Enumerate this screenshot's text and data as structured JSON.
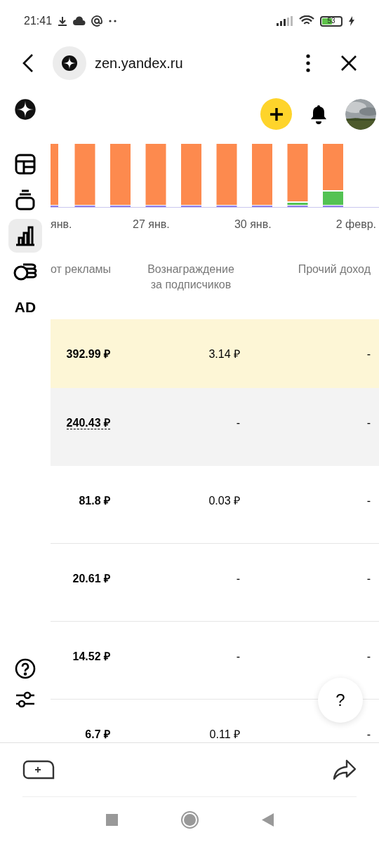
{
  "status_bar": {
    "time": "21:41",
    "battery": "53"
  },
  "browser_bar": {
    "url": "zen.yandex.ru"
  },
  "sidebar": {
    "items": [
      {
        "kind": "layout",
        "selected": false
      },
      {
        "kind": "stack",
        "selected": false
      },
      {
        "kind": "stats",
        "selected": true
      },
      {
        "kind": "coins",
        "selected": false
      },
      {
        "kind": "text",
        "label": "AD",
        "selected": false
      }
    ]
  },
  "chart": {
    "x_labels": [
      "янв.",
      "27 янв.",
      "30 янв.",
      "2 февр."
    ]
  },
  "table": {
    "columns": [
      "от рекламы",
      "Вознаграждение за подписчиков",
      "Прочий доход"
    ],
    "rows": [
      {
        "cells": [
          "392.99 ₽",
          "3.14 ₽",
          "-"
        ],
        "selected": true,
        "hovered": false
      },
      {
        "cells": [
          "240.43 ₽",
          "-",
          "-"
        ],
        "selected": false,
        "hovered": true
      },
      {
        "cells": [
          "81.8 ₽",
          "0.03 ₽",
          "-"
        ],
        "selected": false,
        "hovered": false
      },
      {
        "cells": [
          "20.61 ₽",
          "-",
          "-"
        ],
        "selected": false,
        "hovered": false
      },
      {
        "cells": [
          "14.52 ₽",
          "-",
          "-"
        ],
        "selected": false,
        "hovered": false
      },
      {
        "cells": [
          "6.7 ₽",
          "0.11 ₽",
          "-"
        ],
        "selected": false,
        "hovered": false
      }
    ]
  },
  "help_button": {
    "label": "?"
  }
}
